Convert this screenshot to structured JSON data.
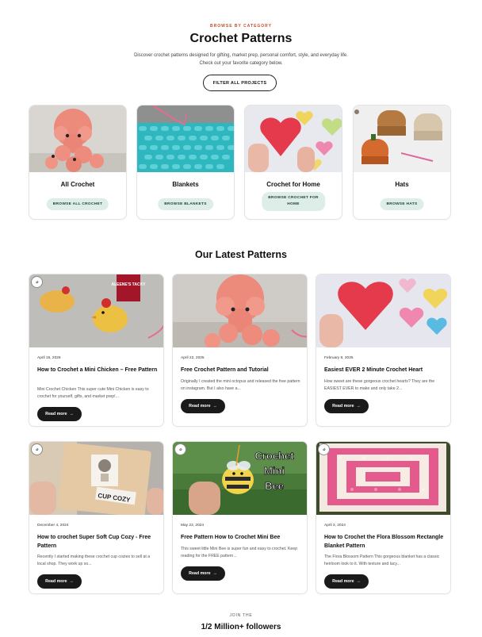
{
  "header": {
    "eyebrow": "BROWSE BY CATEGORY",
    "title": "Crochet Patterns",
    "intro_line1": "Discover crochet patterns designed for gifting, market prep, personal comfort, style, and everyday life.",
    "intro_line2": "Check out your favorite category below.",
    "filter_button": "FILTER ALL PROJECTS"
  },
  "categories": [
    {
      "name": "All Crochet",
      "button": "BROWSE ALL CROCHET"
    },
    {
      "name": "Blankets",
      "button": "BROWSE BLANKETS"
    },
    {
      "name": "Crochet for Home",
      "button_line1": "BROWSE CROCHET FOR",
      "button_line2": "HOME"
    },
    {
      "name": "Hats",
      "button": "BROWSE HATS"
    }
  ],
  "latest": {
    "title": "Our Latest Patterns",
    "read_more": "Read more",
    "posts": [
      {
        "date": "April 15, 2026",
        "title": "How to Crochet a Mini Chicken – Free Pattern",
        "excerpt": "Mini Crochet Chicken This super cute Mini Chicken is easy to crochet for yourself, gifts, and market prep!..."
      },
      {
        "date": "April 22, 2025",
        "title": "Free Crochet Pattern and Tutorial",
        "excerpt": "Originally I created the mini octopus and released the free pattern on instagram. But I also have a..."
      },
      {
        "date": "February 8, 2025",
        "title": "Easiest EVER 2 Minute Crochet Heart",
        "excerpt": "How sweet are these gorgeous crochet hearts? They are the EASIEST EVER to make and only take 2..."
      },
      {
        "date": "December 4, 2024",
        "title": "How to crochet Super Soft Cup Cozy - Free Pattern",
        "excerpt": "Recently I started making these crochet cup cozies to sell at a local shop. They work up so..."
      },
      {
        "date": "May 22, 2024",
        "title": "Free Pattern How to Crochet Mini Bee",
        "excerpt": "This sweet little Mini Bee is super fun and easy to crochet. Keep reading for the FREE pattern..."
      },
      {
        "date": "April 3, 2024",
        "title": "How to Crochet the Flora Blossom Rectangle Blanket Pattern",
        "excerpt": "The Flora Blossom Pattern This gorgeous blanket has a classic heirloom look to it. With texture and lacy..."
      }
    ]
  },
  "image_text": {
    "cup_cozy": "CUP COZY",
    "bee_line1": "Crochet",
    "bee_line2": "Mini",
    "bee_line3": "Bee",
    "glue_label": "ALEENE'S TACKY"
  },
  "footer": {
    "join_label": "JOIN THE",
    "followers": "1/2 Million+ followers"
  },
  "colors": {
    "accent": "#c44a2c",
    "button_dark": "#1a1a1a",
    "mint": "#ddeee8"
  },
  "icons": {
    "arrow": "arrow-right-icon",
    "logo": "site-logo-badge"
  }
}
